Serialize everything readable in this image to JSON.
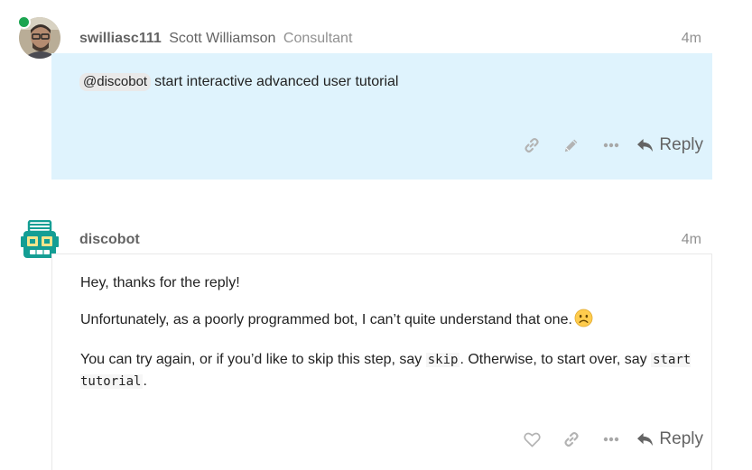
{
  "posts": [
    {
      "username": "swilliasc111",
      "full_name": "Scott Williamson",
      "user_title": "Consultant",
      "date": "4m",
      "online": true,
      "mention": "@discobot",
      "text": "start interactive advanced user tutorial",
      "actions": [
        "link-icon",
        "pencil-icon",
        "ellipsis-icon"
      ],
      "reply_label": "Reply"
    },
    {
      "username": "discobot",
      "date": "4m",
      "paragraphs": {
        "p1": "Hey, thanks for the reply!",
        "p2": "Unfortunately, as a poorly programmed bot, I can’t quite understand that one.",
        "p3_a": "You can try again, or if you’d like to skip this step, say",
        "p3_code1": "skip",
        "p3_b": ". Otherwise, to start over, say",
        "p3_code2": "start tutorial",
        "p3_c": "."
      },
      "emoji": "slightly-frowning-face",
      "actions": [
        "heart-icon",
        "link-icon",
        "ellipsis-icon"
      ],
      "reply_label": "Reply"
    }
  ],
  "colors": {
    "highlight_bg": "#dff3fd",
    "online": "#1ca551",
    "discobot_teal": "#149e94",
    "muted_text": "#919191",
    "icon_gray": "#a8a8a8"
  }
}
